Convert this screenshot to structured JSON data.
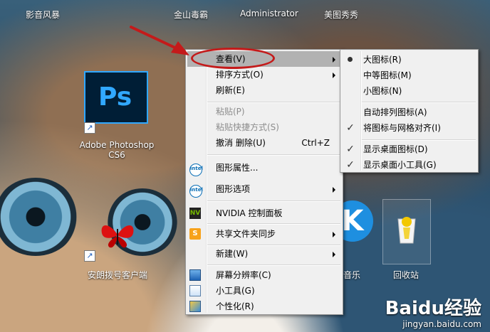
{
  "desktop": {
    "top_labels": [
      "影音风暴",
      "金山毒霸",
      "Administrator",
      "美图秀秀"
    ],
    "icons": {
      "photoshop": "Adobe Photoshop CS6",
      "dialer": "安朗拨号客户端",
      "music": "音乐",
      "recycle": "回收站",
      "ps_glyph": "Ps",
      "k_glyph": "K"
    },
    "watermark": {
      "brand": "Baidu经验",
      "url": "jingyan.baidu.com"
    }
  },
  "context_menu": {
    "items": [
      {
        "label": "查看(V)",
        "has_submenu": true,
        "highlighted": true
      },
      {
        "label": "排序方式(O)",
        "has_submenu": true
      },
      {
        "label": "刷新(E)"
      },
      {
        "label": "粘贴(P)",
        "disabled": true
      },
      {
        "label": "粘贴快捷方式(S)",
        "disabled": true
      },
      {
        "label": "撤消 删除(U)",
        "shortcut": "Ctrl+Z"
      },
      {
        "label": "图形属性...",
        "icon": "intel-icon"
      },
      {
        "label": "图形选项",
        "icon": "intel-icon",
        "has_submenu": true
      },
      {
        "label": "NVIDIA 控制面板",
        "icon": "nvidia-icon"
      },
      {
        "label": "共享文件夹同步",
        "icon": "sync-icon",
        "has_submenu": true
      },
      {
        "label": "新建(W)",
        "has_submenu": true
      },
      {
        "label": "屏幕分辨率(C)",
        "icon": "display-icon"
      },
      {
        "label": "小工具(G)",
        "icon": "gadgets-icon"
      },
      {
        "label": "个性化(R)",
        "icon": "personalize-icon"
      }
    ],
    "intel_glyph": "intel",
    "nvidia_glyph": "NV",
    "sync_glyph": "S"
  },
  "view_submenu": {
    "items": [
      {
        "label": "大图标(R)",
        "selected": true
      },
      {
        "label": "中等图标(M)"
      },
      {
        "label": "小图标(N)"
      },
      {
        "label": "自动排列图标(A)"
      },
      {
        "label": "将图标与网格对齐(I)",
        "checked": true
      },
      {
        "label": "显示桌面图标(D)",
        "checked": true
      },
      {
        "label": "显示桌面小工具(G)",
        "checked": true
      }
    ],
    "check_glyph": "✓"
  },
  "colors": {
    "menu_bg": "#f0f0f0",
    "highlight": "#b2b2b2",
    "annotation": "#c41a1a"
  }
}
